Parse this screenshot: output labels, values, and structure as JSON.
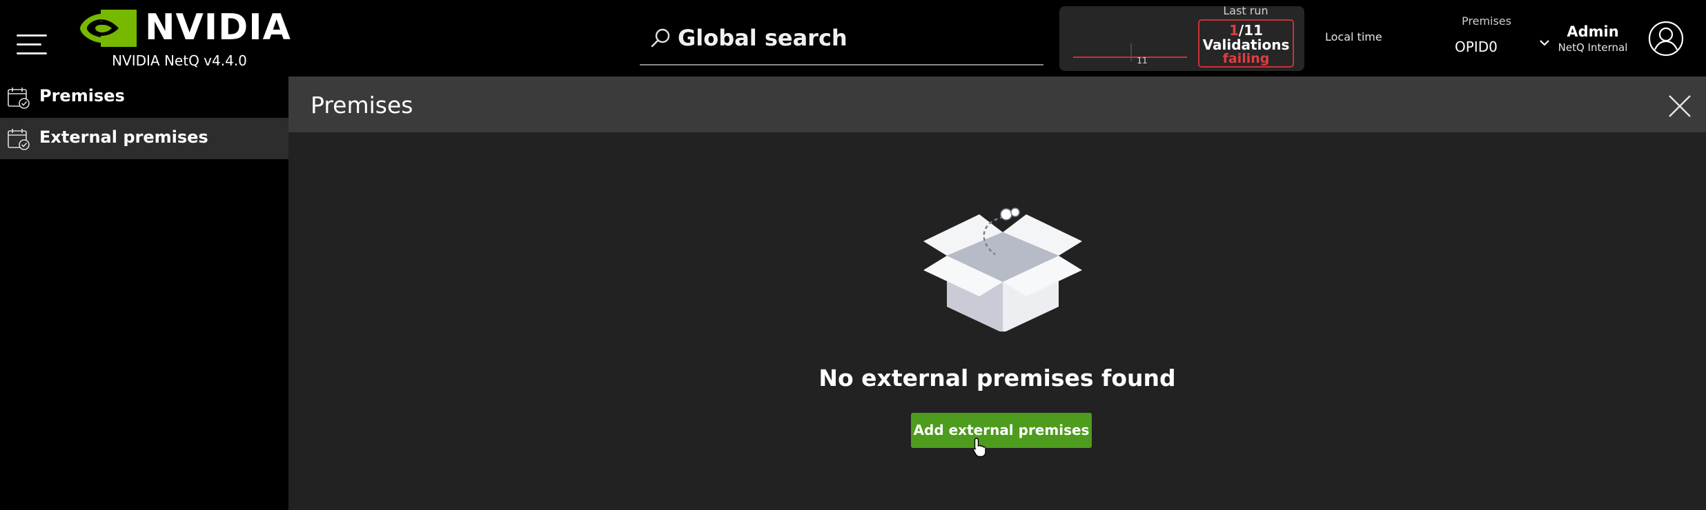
{
  "header": {
    "brand": "NVIDIA",
    "version": "NVIDIA NetQ v4.4.0",
    "search_placeholder": "Global search",
    "validation": {
      "last_run_label": "Last run",
      "failing_count": "1",
      "separator": "/",
      "total_count": "11",
      "title": "Validations",
      "status": "failing",
      "spark_label": "11"
    },
    "local_time_label": "Local time",
    "premises_label": "Premises",
    "premises_value": "OPID0",
    "user_name": "Admin",
    "user_org": "NetQ Internal"
  },
  "sidebar": {
    "items": [
      {
        "label": "Premises",
        "active": false
      },
      {
        "label": "External premises",
        "active": true
      }
    ]
  },
  "main": {
    "title": "Premises",
    "empty_message": "No external premises found",
    "add_button_label": "Add external premises"
  },
  "colors": {
    "brand_green": "#76b900",
    "button_green": "#4e9c1e",
    "failing_red": "#e23c40"
  },
  "icons": {
    "menu": "hamburger-icon",
    "search": "search-icon",
    "close": "close-icon",
    "chevron": "chevron-down-icon",
    "avatar": "user-avatar-icon",
    "calendar": "calendar-check-icon"
  }
}
